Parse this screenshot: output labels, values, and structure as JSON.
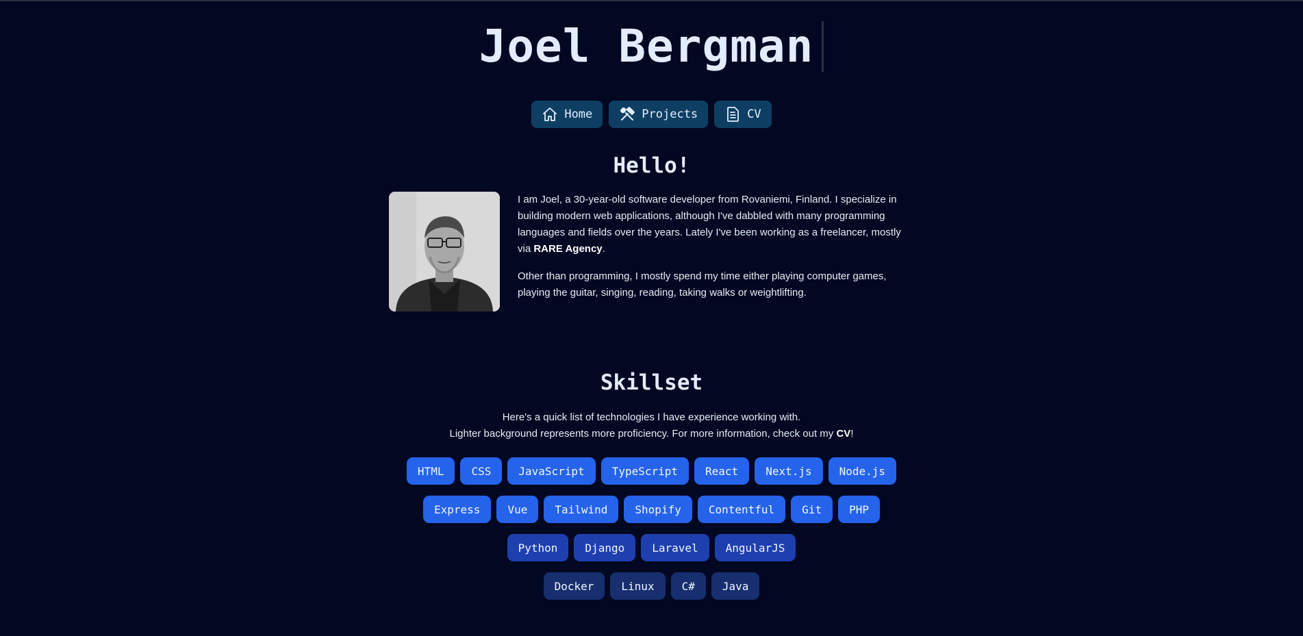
{
  "header": {
    "title": "Joel Bergman"
  },
  "nav": [
    {
      "label": "Home",
      "icon": "home-icon"
    },
    {
      "label": "Projects",
      "icon": "tools-icon"
    },
    {
      "label": "CV",
      "icon": "document-icon"
    }
  ],
  "hello": {
    "heading": "Hello!",
    "paragraph1_pre": "I am Joel, a 30-year-old software developer from Rovaniemi, Finland. I specialize in building modern web applications, although I've dabbled with many programming languages and fields over the years. Lately I've been working as a freelancer, mostly via ",
    "paragraph1_link": "RARE Agency",
    "paragraph1_post": ".",
    "paragraph2": "Other than programming, I mostly spend my time either playing computer games, playing the guitar, singing, reading, taking walks or weightlifting."
  },
  "skillset": {
    "heading": "Skillset",
    "line1": "Here's a quick list of technologies I have experience working with.",
    "line2_pre": "Lighter background represents more proficiency. For more information, check out my ",
    "line2_link": "CV",
    "line2_post": "!",
    "rows": [
      {
        "level": 1,
        "items": [
          "HTML",
          "CSS",
          "JavaScript",
          "TypeScript",
          "React",
          "Next.js",
          "Node.js"
        ]
      },
      {
        "level": 1,
        "items": [
          "Express",
          "Vue",
          "Tailwind",
          "Shopify",
          "Contentful",
          "Git",
          "PHP"
        ]
      },
      {
        "level": 2,
        "items": [
          "Python",
          "Django",
          "Laravel",
          "AngularJS"
        ]
      },
      {
        "level": 3,
        "items": [
          "Docker",
          "Linux",
          "C#",
          "Java"
        ]
      }
    ]
  },
  "colors": {
    "background": "#020822",
    "nav_button": "#0e3f63",
    "chip_level1": "#2563eb",
    "chip_level2": "#1e40af",
    "chip_level3": "#172f6e"
  }
}
